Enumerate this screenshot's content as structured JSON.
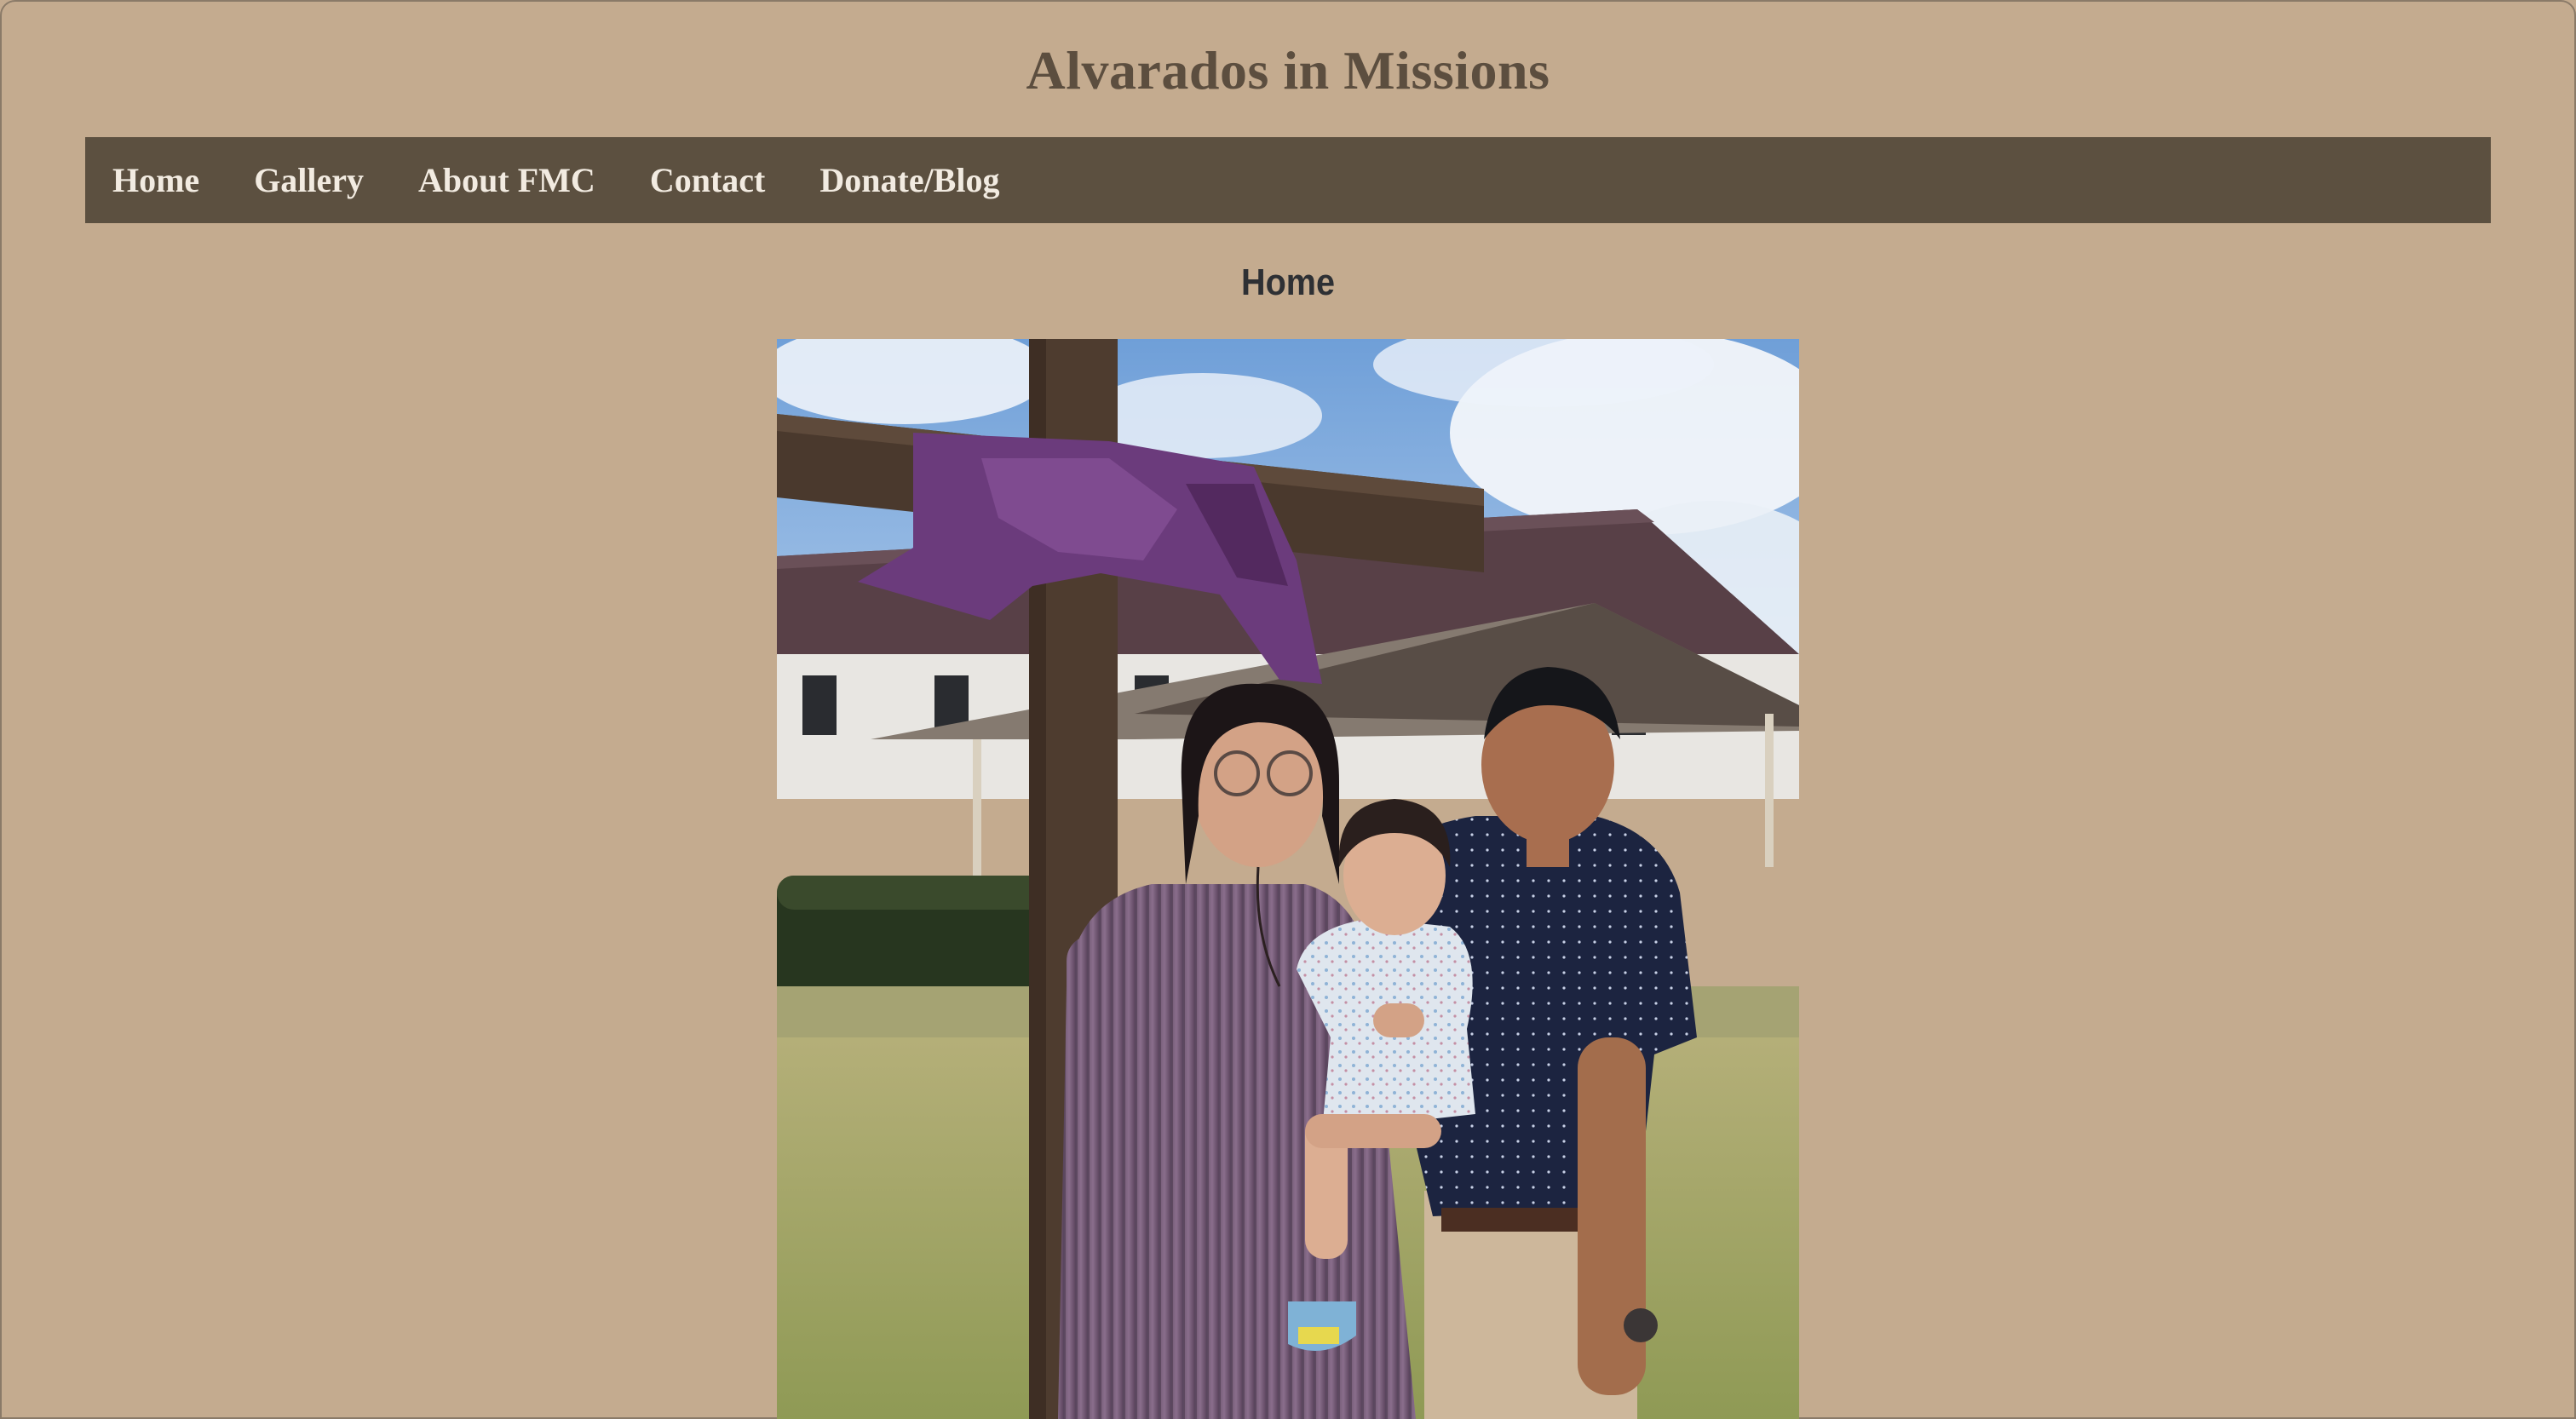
{
  "site": {
    "title": "Alvarados in Missions"
  },
  "nav": {
    "items": [
      {
        "label": "Home"
      },
      {
        "label": "Gallery"
      },
      {
        "label": "About FMC"
      },
      {
        "label": "Contact"
      },
      {
        "label": "Donate/Blog"
      }
    ]
  },
  "main": {
    "heading": "Home"
  }
}
